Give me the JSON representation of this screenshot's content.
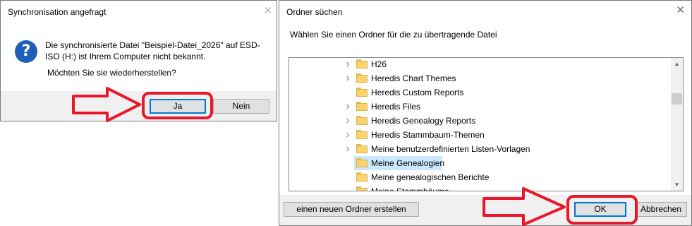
{
  "sync_dialog": {
    "title": "Synchronisation angefragt",
    "close_glyph": "✕",
    "message": "Die synchronisierte Datei \"Beispiel-Datei_2026\" auf ESD-ISO (H:) ist Ihrem Computer nicht bekannt.",
    "question": "Möchten Sie sie wiederherstellen?",
    "icon": "question-icon",
    "yes_label": "Ja",
    "no_label": "Nein"
  },
  "folder_dialog": {
    "title": "Ordner süchen",
    "close_glyph": "✕",
    "subtitle": "Wählen Sie einen Ordner für die zu übertragende Datei",
    "items": [
      {
        "label": "H26",
        "expandable": true,
        "selected": false
      },
      {
        "label": "Heredis Chart Themes",
        "expandable": true,
        "selected": false
      },
      {
        "label": "Heredis Custom Reports",
        "expandable": false,
        "selected": false
      },
      {
        "label": "Heredis Files",
        "expandable": true,
        "selected": false
      },
      {
        "label": "Heredis Genealogy Reports",
        "expandable": true,
        "selected": false
      },
      {
        "label": "Heredis Stammbaum-Themen",
        "expandable": true,
        "selected": false
      },
      {
        "label": "Meine benutzerdefinierten Listen-Vorlagen",
        "expandable": true,
        "selected": false
      },
      {
        "label": "Meine Genealogien",
        "expandable": false,
        "selected": true
      },
      {
        "label": "Meine genealogischen Berichte",
        "expandable": false,
        "selected": false
      },
      {
        "label": "Meine Stammbäume",
        "expandable": false,
        "selected": false
      }
    ],
    "new_folder_label": "einen neuen Ordner erstellen",
    "ok_label": "OK",
    "cancel_label": "Abbrechen"
  },
  "annotation_color": "#e8172b"
}
